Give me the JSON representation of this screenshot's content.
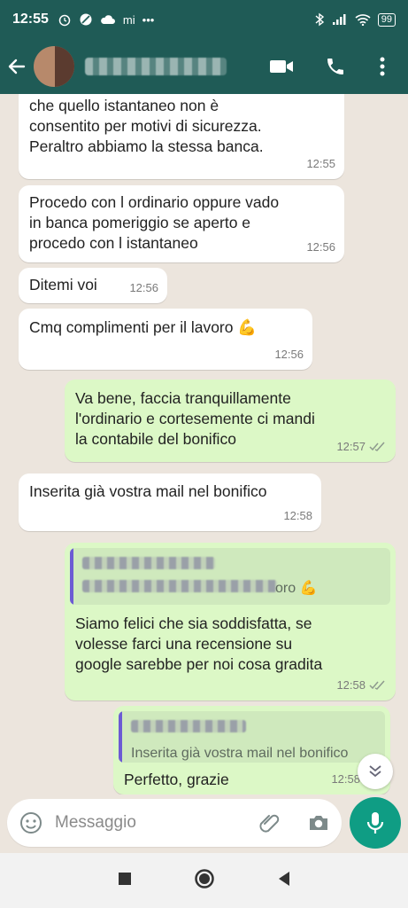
{
  "status_bar": {
    "time": "12:55",
    "carrier_label": "mi",
    "more": "•••",
    "battery": "99"
  },
  "header": {
    "contact_name": "",
    "icons": [
      "back-arrow-icon",
      "video-call-icon",
      "phone-icon",
      "more-vert-icon"
    ]
  },
  "messages": [
    {
      "direction": "in",
      "text": "che quello istantaneo non è\nconsentito per motivi di sicurezza.\nPeraltro abbiamo la stessa banca.",
      "time": "12:55"
    },
    {
      "direction": "in",
      "text": "Procedo con l ordinario oppure vado\nin banca pomeriggio se aperto e\nprocedo con l istantaneo",
      "time": "12:56"
    },
    {
      "direction": "in",
      "text": "Ditemi voi",
      "time": "12:56"
    },
    {
      "direction": "in",
      "text": "Cmq complimenti per il lavoro 💪",
      "time": "12:56"
    },
    {
      "direction": "out",
      "text": "Va bene, faccia tranquillamente\nl'ordinario e cortesemente ci mandi\nla contabile del bonifico",
      "time": "12:57",
      "status": "read"
    },
    {
      "direction": "in",
      "text": "Inserita già vostra mail nel bonifico",
      "time": "12:58"
    },
    {
      "direction": "out",
      "quote_visible": "oro 💪",
      "text": "Siamo felici che sia soddisfatta, se\nvolesse farci una recensione su\ngoogle sarebbe per noi cosa gradita",
      "time": "12:58",
      "status": "read"
    },
    {
      "direction": "out",
      "quote_visible": "Inserita già vostra mail nel bonifico",
      "text": "Perfetto, grazie",
      "time": "12:58",
      "status": "read"
    }
  ],
  "composer": {
    "placeholder": "Messaggio",
    "icons": [
      "emoji-icon",
      "attach-icon",
      "camera-icon",
      "mic-icon"
    ]
  },
  "nav": {
    "icons": [
      "recents-square-icon",
      "home-circle-icon",
      "back-triangle-icon"
    ]
  },
  "colors": {
    "header": "#1f5b56",
    "incoming_bubble": "#ffffff",
    "outgoing_bubble": "#dcf8c6",
    "chat_background": "#ece5dd",
    "mic_button": "#0f9d84",
    "quote_bar": "#6c5bd4"
  }
}
